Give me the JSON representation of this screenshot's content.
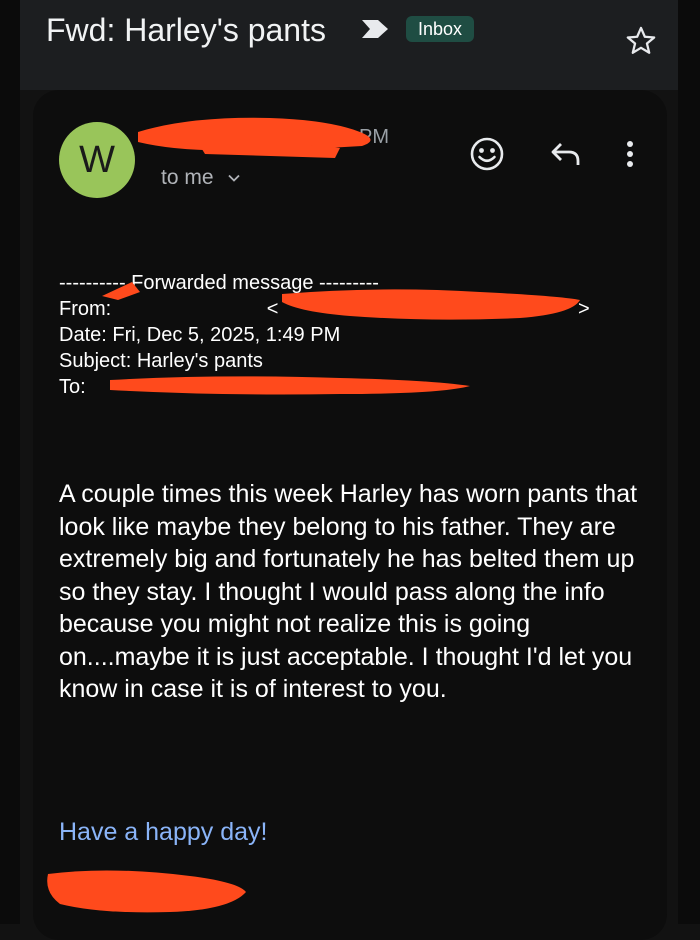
{
  "header": {
    "subject": "Fwd: Harley's pants",
    "label_badge": "Inbox",
    "importance_icon": "importance-marker-icon",
    "star_icon": "star-outline-icon"
  },
  "message": {
    "avatar_initial": "W",
    "avatar_color": "#99c55a",
    "time_fragment": "PM",
    "recipient_label": "to me",
    "actions": [
      "emoji-react-icon",
      "reply-icon",
      "more-vertical-icon"
    ]
  },
  "forwarded": {
    "separator": "---------- Forwarded message ---------",
    "from_label": "From:",
    "from_tail": "<",
    "from_end": ">",
    "date_line": "Date: Fri, Dec 5, 2025, 1:49 PM",
    "subject_line": "Subject: Harley's pants",
    "to_label": "To:"
  },
  "body": {
    "paragraph": "A couple times this week Harley has worn pants that look like maybe they belong to his father. They are extremely big and fortunately he has belted them up so they stay.  I thought I would pass along the info because you might not realize this is going on....maybe it is just acceptable.  I thought I'd let you know in case it is of interest to you.",
    "signoff": "Have a happy day!"
  },
  "colors": {
    "background": "#121212",
    "card": "#0d0d0d",
    "badge": "#1f4d43",
    "link": "#8ab4f8",
    "redaction": "#ff4a1c"
  }
}
